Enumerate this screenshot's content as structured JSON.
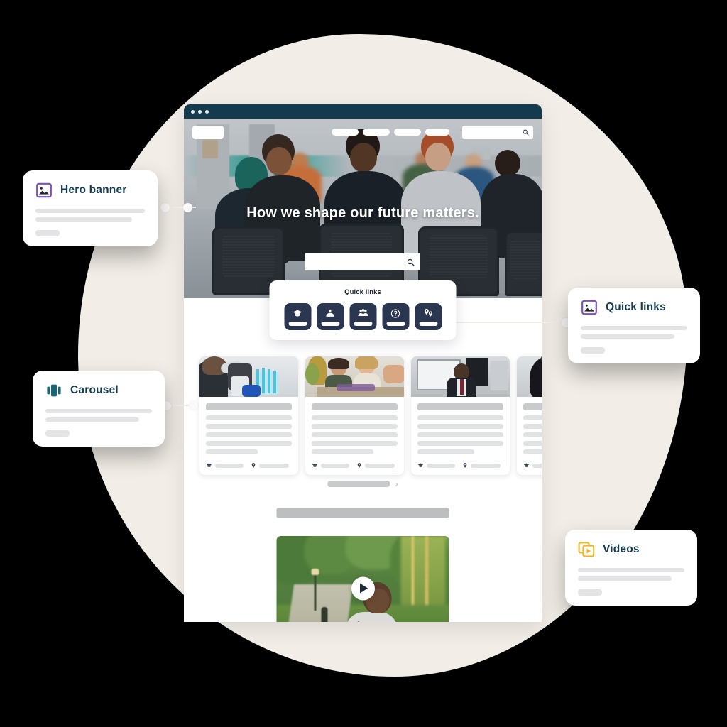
{
  "background": {
    "blob_color": "#F2EDE7",
    "page_color": "#000000"
  },
  "browser": {
    "titlebar_color": "#143A4E",
    "dots": [
      "window-dot-1",
      "window-dot-2",
      "window-dot-3"
    ]
  },
  "nav": {
    "logo": "site-logo-placeholder",
    "items": [
      "nav-item-1",
      "nav-item-2",
      "nav-item-3",
      "nav-item-4"
    ],
    "search_icon": "search-icon"
  },
  "hero": {
    "headline": "How we shape our future matters.",
    "search_placeholder": "",
    "search_value": "",
    "search_icon": "search-icon"
  },
  "quick_links": {
    "title": "Quick links",
    "tile_color": "#2B3750",
    "tiles": [
      {
        "icon": "graduation-cap-icon",
        "label": ""
      },
      {
        "icon": "person-umbrella-icon",
        "label": ""
      },
      {
        "icon": "people-group-icon",
        "label": ""
      },
      {
        "icon": "question-circle-icon",
        "label": ""
      },
      {
        "icon": "map-pins-icon",
        "label": ""
      }
    ]
  },
  "carousel": {
    "cards": [
      {
        "image": "student-in-science-lab",
        "lines": 5,
        "foot_icons": [
          "graduation-cap-icon",
          "location-pin-icon"
        ]
      },
      {
        "image": "students-at-workshop-table",
        "lines": 5,
        "foot_icons": [
          "graduation-cap-icon",
          "location-pin-icon"
        ]
      },
      {
        "image": "lecturer-presenting-at-whiteboard",
        "lines": 5,
        "foot_icons": [
          "graduation-cap-icon",
          "location-pin-icon"
        ]
      },
      {
        "image": "student-portrait",
        "lines": 5,
        "foot_icons": [
          "graduation-cap-icon",
          "location-pin-icon"
        ]
      }
    ],
    "progress_label": "carousel-progress",
    "next_icon": "chevron-right-icon"
  },
  "video_section": {
    "heading_placeholder": "section-heading-placeholder",
    "thumbnail": "student-walking-on-campus-path",
    "play_icon": "play-icon"
  },
  "annotations": [
    {
      "key": "hero-banner",
      "title": "Hero banner",
      "icon": "image-icon",
      "icon_color": "#7B4FBF",
      "lines": 2,
      "chip": true
    },
    {
      "key": "quick-links",
      "title": "Quick links",
      "icon": "image-icon",
      "icon_color": "#7B4FBF",
      "lines": 2,
      "chip": true
    },
    {
      "key": "carousel",
      "title": "Carousel",
      "icon": "carousel-icon",
      "icon_color": "#1C6374",
      "lines": 2,
      "chip": true
    },
    {
      "key": "videos",
      "title": "Videos",
      "icon": "video-icon",
      "icon_color": "#F0B323",
      "lines": 2,
      "chip": true
    }
  ]
}
